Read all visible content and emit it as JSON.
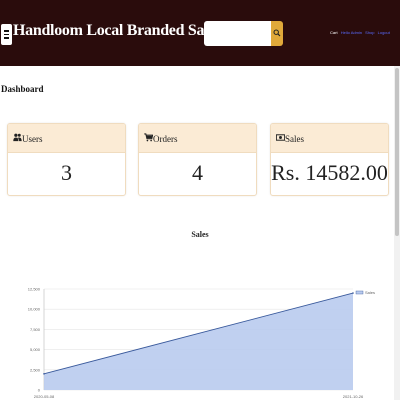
{
  "header": {
    "brand": "Handloom Local Branded Saree",
    "search_placeholder": "",
    "nav": {
      "cart": "Cart",
      "links": [
        "Hello Admin",
        "Shop",
        "Logout"
      ]
    }
  },
  "page": {
    "title": "Dashboard"
  },
  "cards": [
    {
      "label": "Users",
      "value": "3",
      "icon": "users-icon"
    },
    {
      "label": "Orders",
      "value": "4",
      "icon": "cart-icon"
    },
    {
      "label": "Sales",
      "value": "Rs. 14582.00",
      "icon": "money-icon"
    }
  ],
  "chart": {
    "title": "Sales"
  },
  "chart_data": {
    "type": "area",
    "title": "Sales",
    "series": [
      {
        "name": "Sales",
        "color": "#b9cbee",
        "x": [
          "2020-05-08",
          "2021-10-26"
        ],
        "values": [
          2000,
          12000
        ]
      }
    ],
    "x_tick_labels": [
      "2020-05-08",
      "2021-10-26"
    ],
    "y_ticks": [
      0,
      2500,
      5000,
      7500,
      10000,
      12500
    ],
    "y_tick_labels": [
      "0",
      "2,500",
      "5,000",
      "7,500",
      "10,000",
      "12,500"
    ],
    "ylim": [
      0,
      12500
    ],
    "legend": "right",
    "grid": true
  },
  "colors": {
    "topbar": "#2a0c0c",
    "accent": "#e0a93a",
    "card_header": "#fbebd5",
    "area_fill": "#b9cbee",
    "area_line": "#3a5a9c"
  }
}
